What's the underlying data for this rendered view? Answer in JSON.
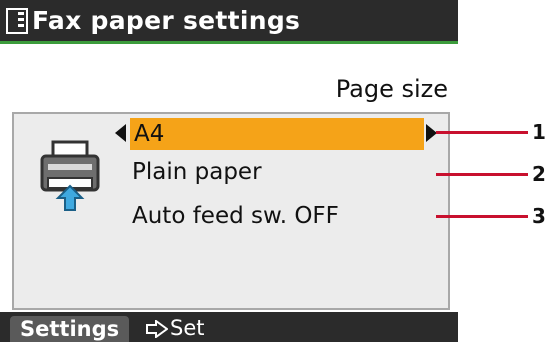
{
  "header": {
    "title": "Fax paper settings",
    "icon": "fax-settings-icon"
  },
  "section": {
    "label": "Page size"
  },
  "settings": {
    "items": [
      {
        "label": "A4",
        "selected": true
      },
      {
        "label": "Plain paper",
        "selected": false
      },
      {
        "label": "Auto feed sw. OFF",
        "selected": false
      }
    ]
  },
  "callouts": [
    "1",
    "2",
    "3"
  ],
  "footer": {
    "settings_label": "Settings",
    "set_label": "Set",
    "set_icon": "arrow-set-icon"
  },
  "colors": {
    "selection": "#f5a318",
    "accent_line": "#3c9c3c",
    "callout_line": "#c8102e"
  }
}
